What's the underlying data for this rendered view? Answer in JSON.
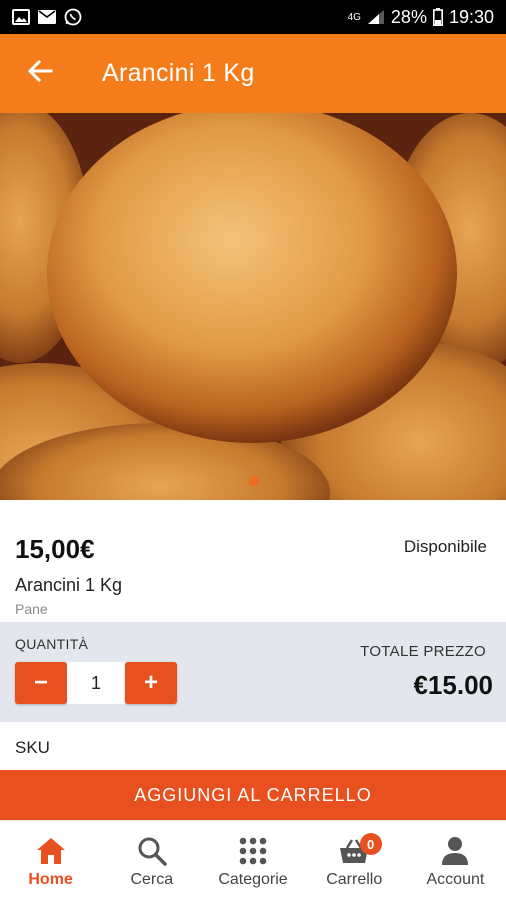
{
  "status_bar": {
    "signal_label": "4G",
    "battery": "28%",
    "time": "19:30",
    "icons": [
      "gallery-icon",
      "mail-icon",
      "whatsapp-icon",
      "signal-icon",
      "battery-icon"
    ]
  },
  "header": {
    "title": "Arancini 1 Kg",
    "back_icon": "arrow-left-icon"
  },
  "product": {
    "price": "15,00€",
    "availability": "Disponibile",
    "name": "Arancini 1 Kg",
    "category": "Pane",
    "gallery_index": 1,
    "gallery_count": 1
  },
  "quantity": {
    "label": "QUANTITÀ",
    "value": "1",
    "minus": "−",
    "plus": "+"
  },
  "total": {
    "label": "TOTALE PREZZO",
    "value": "€15.00"
  },
  "sku_label": "SKU",
  "add_to_cart": "AGGIUNGI AL CARRELLO",
  "nav": {
    "items": [
      {
        "label": "Home",
        "icon": "home-icon",
        "active": true
      },
      {
        "label": "Cerca",
        "icon": "search-icon",
        "active": false
      },
      {
        "label": "Categorie",
        "icon": "grid-icon",
        "active": false
      },
      {
        "label": "Carrello",
        "icon": "basket-icon",
        "active": false,
        "badge": "0"
      },
      {
        "label": "Account",
        "icon": "person-icon",
        "active": false
      }
    ]
  },
  "colors": {
    "primary": "#f57c1b",
    "accent": "#e9501f",
    "panel": "#e3e6ec"
  }
}
